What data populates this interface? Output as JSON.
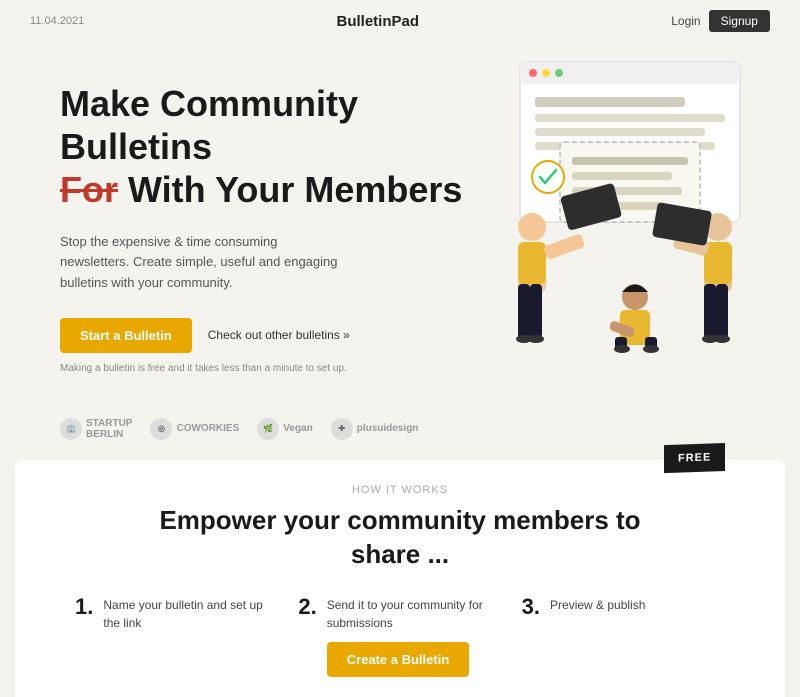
{
  "header": {
    "date": "11.04.2021",
    "logo": "BulletinPad",
    "login_label": "Login",
    "signup_label": "Signup"
  },
  "hero": {
    "title_line1": "Make Community Bulletins",
    "title_strikethrough": "For",
    "title_line2": "With Your Members",
    "subtitle": "Stop the expensive & time consuming newsletters. Create simple, useful and engaging bulletins with your community.",
    "cta_start": "Start a Bulletin",
    "cta_check": "Check out other bulletins »",
    "note": "Making a bulletin is free and it takes less than a minute to set up."
  },
  "logos": [
    {
      "name": "STARTUP BERLIN",
      "icon": "🏢"
    },
    {
      "name": "COWORKIES",
      "icon": "👥"
    },
    {
      "name": "Vegan",
      "icon": "🌱"
    },
    {
      "name": "plusuidesign",
      "icon": "✚"
    }
  ],
  "bottom": {
    "badge": "FREE",
    "how_label": "HOW IT WORKS",
    "title_line1": "Empower your community members to",
    "title_line2": "share ...",
    "steps": [
      {
        "number": "1.",
        "text": "Name your bulletin and set up the link"
      },
      {
        "number": "2.",
        "text": "Send it to your community for submissions"
      },
      {
        "number": "3.",
        "text": "Preview & publish"
      }
    ],
    "create_label": "Create a Bulletin"
  }
}
